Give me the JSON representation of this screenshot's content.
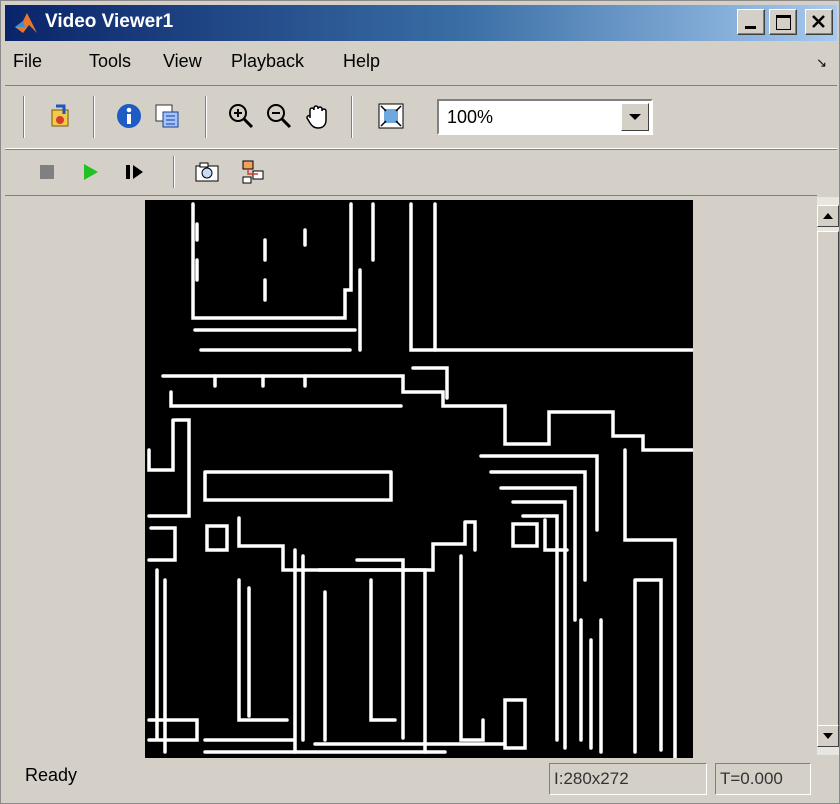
{
  "window": {
    "title": "Video Viewer1"
  },
  "title_buttons": [
    "minimize",
    "maximize",
    "close"
  ],
  "menu": [
    "File",
    "Tools",
    "View",
    "Playback",
    "Help"
  ],
  "toolbar": {
    "zoom_value": "100%"
  },
  "status": {
    "text": "Ready",
    "image_size": "I:280x272",
    "time": "T=0.000"
  },
  "colors": {
    "title_start": "#0a246a",
    "title_end": "#a6caf0",
    "chrome": "#d4d0c8",
    "play_green": "#22c022"
  }
}
